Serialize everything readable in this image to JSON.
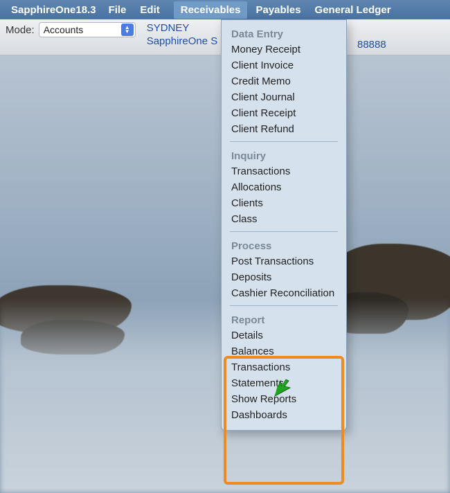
{
  "menubar": {
    "appname": "SapphireOne18.3",
    "items": [
      "File",
      "Edit",
      "Receivables",
      "Payables",
      "General Ledger"
    ],
    "active_index": 2
  },
  "toolbar": {
    "mode_label": "Mode:",
    "mode_value": "Accounts",
    "location": "SYDNEY",
    "company": "SapphireOne S",
    "number": "88888"
  },
  "dropdown": {
    "sections": [
      {
        "title": "Data Entry",
        "items": [
          "Money Receipt",
          "Client Invoice",
          "Credit Memo",
          "Client Journal",
          "Client Receipt",
          "Client Refund"
        ]
      },
      {
        "title": "Inquiry",
        "items": [
          "Transactions",
          "Allocations",
          "Clients",
          "Class"
        ]
      },
      {
        "title": "Process",
        "items": [
          "Post Transactions",
          "Deposits",
          "Cashier Reconciliation"
        ]
      },
      {
        "title": "Report",
        "items": [
          "Details",
          "Balances",
          "Transactions",
          "Statements",
          "Show Reports",
          "Dashboards"
        ]
      }
    ]
  }
}
